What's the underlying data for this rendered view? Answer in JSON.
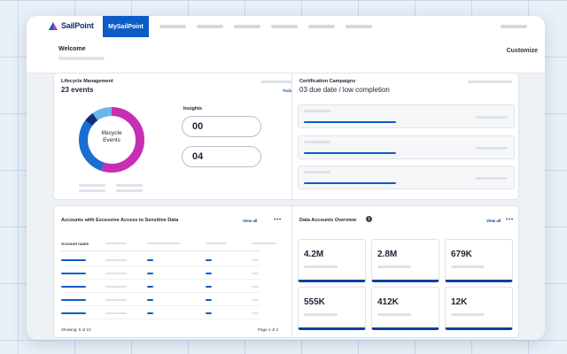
{
  "topbar": {
    "brand": "SailPoint",
    "active_tab": "MySailPoint",
    "colors": {
      "brand_navy": "#0b2f73",
      "accent_blue": "#0b5cc7"
    }
  },
  "header": {
    "welcome": "Welcome",
    "customize": "Customize"
  },
  "lifecycle": {
    "title": "Lifecycle Management",
    "count": "23 events",
    "today_link": "Today",
    "donut_label_line1": "lifecycle",
    "donut_label_line2": "Events",
    "insights_title": "Insights",
    "insights": [
      "00",
      "04"
    ],
    "donut_segments": [
      {
        "name": "magenta",
        "fraction": 0.55,
        "color": "#c62fb4"
      },
      {
        "name": "blue",
        "fraction": 0.3,
        "color": "#1a6dd1"
      },
      {
        "name": "navy",
        "fraction": 0.05,
        "color": "#0f2f7a"
      },
      {
        "name": "light-blue",
        "fraction": 0.1,
        "color": "#69b6ea"
      }
    ]
  },
  "certification": {
    "title": "Certification Campaigns",
    "subtitle": "03 due date / low completion",
    "campaigns_progress": [
      0.45,
      0.45,
      0.45
    ]
  },
  "accounts": {
    "title": "Accounts with Excessive Access to Sensitive Data",
    "view_all": "View all",
    "more": "•••",
    "column_header": "Account name",
    "rows": 5,
    "showing": "Showing:  5 of 10",
    "page": "Page 1 of 2"
  },
  "data_accounts": {
    "title": "Data Accounts Overview",
    "info_icon": "info-icon",
    "view_all": "View all",
    "more": "•••",
    "tiles": [
      "4.2M",
      "2.8M",
      "679K",
      "555K",
      "412K",
      "12K"
    ]
  }
}
